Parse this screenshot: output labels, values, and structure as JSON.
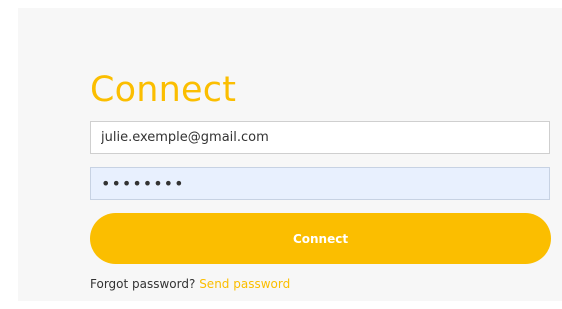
{
  "form": {
    "title": "Connect",
    "email_value": "julie.exemple@gmail.com",
    "password_value": "••••••••",
    "button_label": "Connect",
    "forgot_text": "Forgot password?",
    "send_link": "Send password"
  },
  "colors": {
    "accent": "#fbbe00",
    "panel_bg": "#f7f7f7",
    "autofill_bg": "#e8f0fe"
  }
}
